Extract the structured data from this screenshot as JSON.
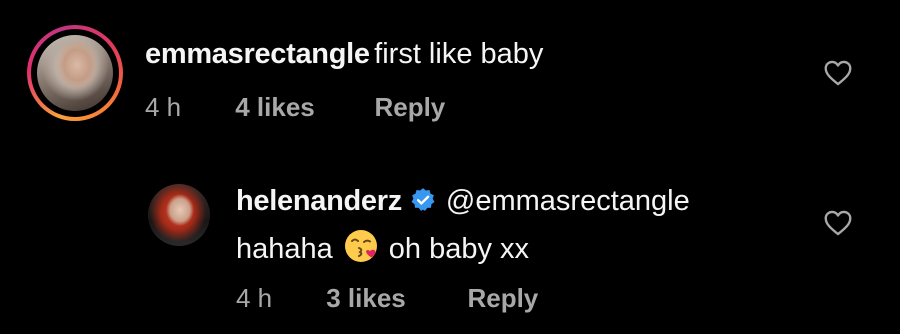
{
  "comments": [
    {
      "username": "emmasrectangle",
      "text": "first like baby",
      "time": "4 h",
      "likes": "4 likes",
      "reply_label": "Reply",
      "avatar_ring": true,
      "icons": {
        "like": "heart-outline-icon"
      }
    },
    {
      "username": "helenanderz",
      "verified": true,
      "mention": "@emmasrectangle",
      "text_before_emoji": "hahaha",
      "emoji": "kissing-face-with-heart-emoji",
      "text_after_emoji": "oh baby xx",
      "time": "4 h",
      "likes": "3 likes",
      "reply_label": "Reply",
      "icons": {
        "like": "heart-outline-icon",
        "verified": "verified-badge-icon"
      }
    }
  ],
  "colors": {
    "background": "#000000",
    "text_primary": "#f5f5f5",
    "text_secondary": "#a8a8a8",
    "verified_blue": "#3897f0"
  }
}
